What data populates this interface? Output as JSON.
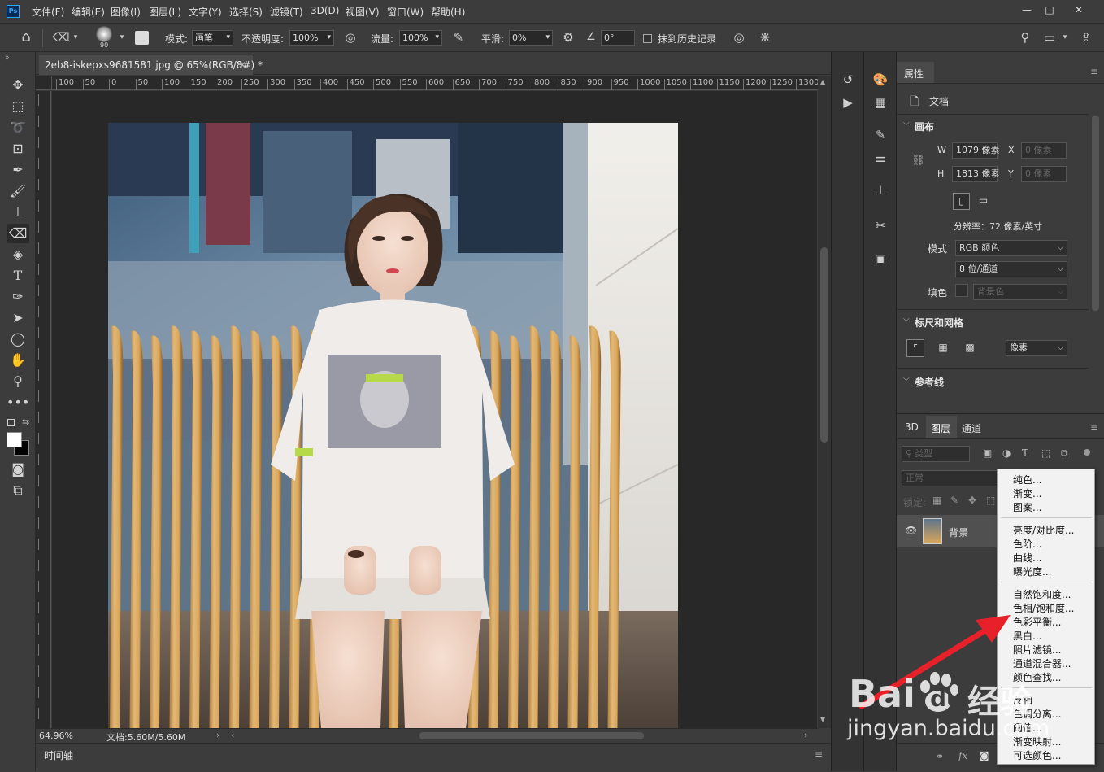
{
  "app": {
    "logo_text": "Ps"
  },
  "menubar": {
    "items": [
      "文件(F)",
      "编辑(E)",
      "图像(I)",
      "图层(L)",
      "文字(Y)",
      "选择(S)",
      "滤镜(T)",
      "3D(D)",
      "视图(V)",
      "窗口(W)",
      "帮助(H)"
    ],
    "window_buttons": [
      "—",
      "□",
      "✕"
    ]
  },
  "options": {
    "brush_size": "90",
    "mode_label": "模式:",
    "mode_value": "画笔",
    "opacity_label": "不透明度:",
    "opacity_value": "100%",
    "flow_label": "流量:",
    "flow_value": "100%",
    "smooth_label": "平滑:",
    "smooth_value": "0%",
    "angle_value": "0°",
    "erase_history_label": "抹到历史记录"
  },
  "document": {
    "tab_title": "2eb8-iskepxs9681581.jpg @ 65%(RGB/8#) *",
    "ruler_h": [
      "100",
      "50",
      "0",
      "50",
      "100",
      "150",
      "200",
      "250",
      "300",
      "350",
      "400",
      "450",
      "500",
      "550",
      "600",
      "650",
      "700",
      "750",
      "800",
      "850",
      "900",
      "950",
      "1000",
      "1050",
      "1100",
      "1150",
      "1200",
      "1250",
      "1300"
    ],
    "zoom": "64.96%",
    "doc_size": "文档:5.60M/5.60M"
  },
  "timeline": {
    "label": "时间轴"
  },
  "properties": {
    "tab": "属性",
    "doc_label": "文档",
    "canvas_head": "画布",
    "w_label": "W",
    "w_value": "1079 像素",
    "h_label": "H",
    "h_value": "1813 像素",
    "x_label": "X",
    "x_value": "0 像素",
    "y_label": "Y",
    "y_value": "0 像素",
    "resolution": "分辨率：72 像素/英寸",
    "mode_label": "模式",
    "mode_value": "RGB 颜色",
    "depth_value": "8 位/通道",
    "fill_label": "填色",
    "fill_value": "背景色",
    "rulers_head": "标尺和网格",
    "unit_value": "像素",
    "guides_head": "参考线"
  },
  "layers": {
    "tabs": [
      "3D",
      "图层",
      "通道"
    ],
    "filter_placeholder": "类型",
    "blend_mode": "正常",
    "lock_label": "锁定:",
    "layer_name": "背景"
  },
  "context_menu": {
    "group1": [
      "纯色...",
      "渐变...",
      "图案..."
    ],
    "group2": [
      "亮度/对比度...",
      "色阶...",
      "曲线...",
      "曝光度..."
    ],
    "group3": [
      "自然饱和度...",
      "色相/饱和度...",
      "色彩平衡...",
      "黑白...",
      "照片滤镜...",
      "通道混合器...",
      "颜色查找..."
    ],
    "group4": [
      "反相",
      "色调分离...",
      "阈值...",
      "渐变映射...",
      "可选颜色..."
    ]
  },
  "watermark": {
    "line1": "Bai",
    "line1b": "du",
    "line1c": "经验",
    "line2": "jingyan.baidu.com"
  },
  "colors": {
    "accent_arrow": "#e8202a",
    "panel_bg": "#3c3c3c",
    "canvas_bg": "#282828"
  }
}
